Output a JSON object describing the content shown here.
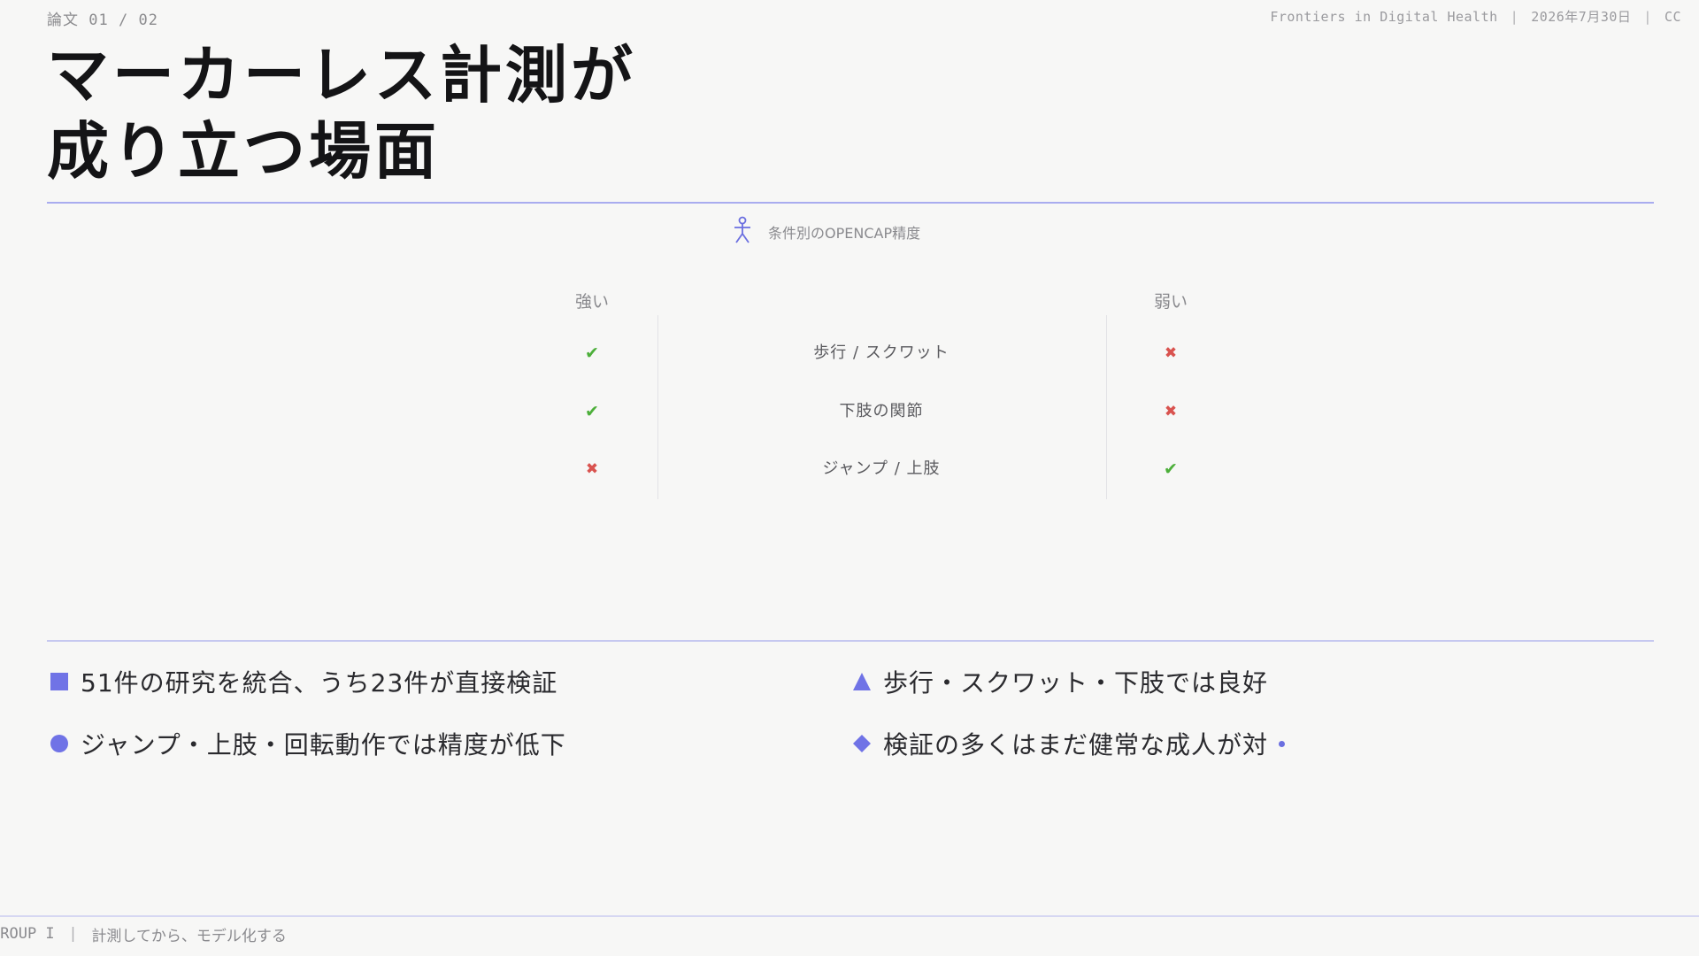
{
  "header": {
    "page_label": "論文",
    "page_current": "01",
    "page_total": "02",
    "journal": "Frontiers in Digital Health",
    "date": "2026年7月30日",
    "license": "CC"
  },
  "title": {
    "line1": "マーカーレス計測が",
    "line2": "成り立つ場面"
  },
  "chart": {
    "caption": "条件別のOPENCAP精度",
    "icon": "stick-figure-icon",
    "col_strong": "強い",
    "col_weak": "弱い",
    "rows": [
      {
        "label": "歩行 / スクワット",
        "strong": "✔",
        "weak": "✖"
      },
      {
        "label": "下肢の関節",
        "strong": "✔",
        "weak": "✖"
      },
      {
        "label": "ジャンプ / 上肢",
        "strong": "✖",
        "weak": "✔"
      }
    ]
  },
  "bullets": [
    {
      "shape": "square",
      "text": "51件の研究を統合、うち23件が直接検証"
    },
    {
      "shape": "triangle",
      "text": "歩行・スクワット・下肢では良好"
    },
    {
      "shape": "circle",
      "text": "ジャンプ・上肢・回転動作では精度が低下"
    },
    {
      "shape": "diamond",
      "text": "検証の多くはまだ健常な成人が対"
    }
  ],
  "footer": {
    "group": "GROUP I",
    "tagline": "計測してから、モデル化する"
  },
  "colors": {
    "accent": "#7073e6",
    "check": "#4caf3a",
    "cross": "#d9534f",
    "rule": "#c6c8f0"
  }
}
